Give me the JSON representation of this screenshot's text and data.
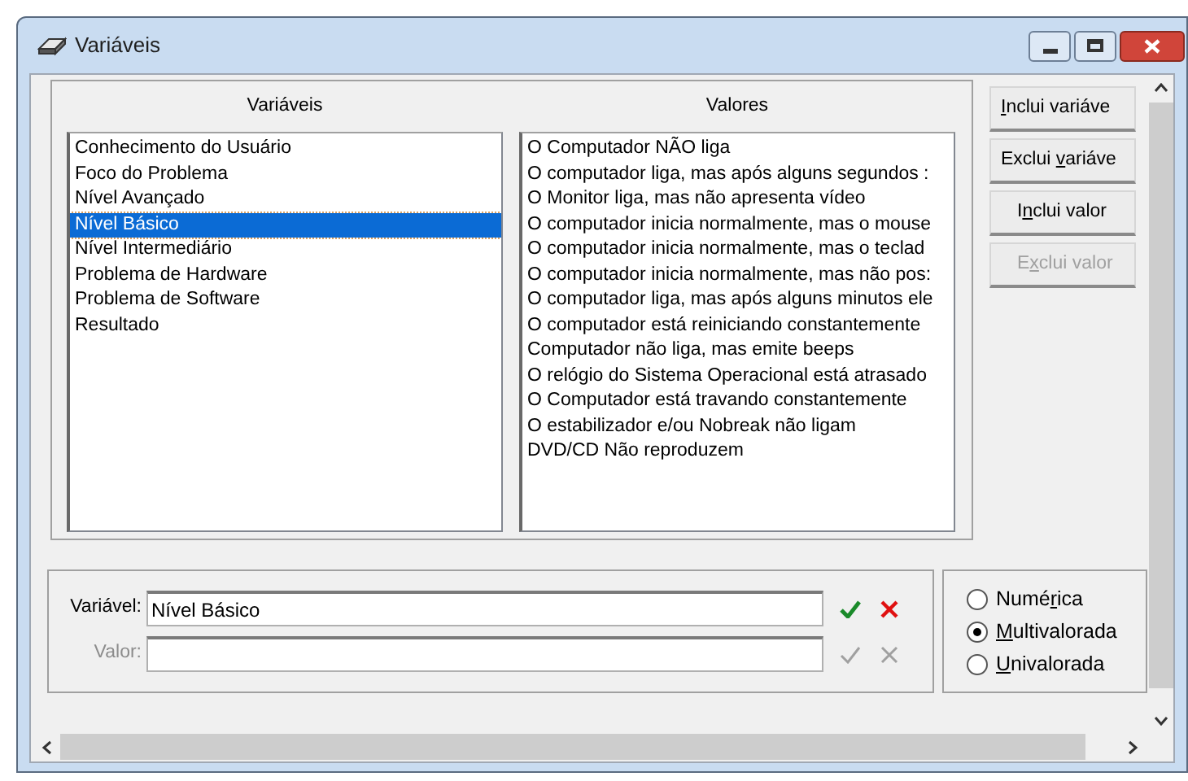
{
  "window": {
    "title": "Variáveis"
  },
  "variables": {
    "heading": "Variáveis",
    "items": [
      {
        "label": "Conhecimento do Usuário",
        "selected": false
      },
      {
        "label": "Foco do Problema",
        "selected": false
      },
      {
        "label": "Nível Avançado",
        "selected": false
      },
      {
        "label": "Nível Básico",
        "selected": true
      },
      {
        "label": "Nível Intermediário",
        "selected": false
      },
      {
        "label": "Problema de Hardware",
        "selected": false
      },
      {
        "label": "Problema de Software",
        "selected": false
      },
      {
        "label": "Resultado",
        "selected": false
      }
    ]
  },
  "values": {
    "heading": "Valores",
    "items": [
      "O Computador NÃO liga",
      "O computador liga, mas após alguns segundos :",
      "O Monitor liga, mas não apresenta vídeo",
      "O computador inicia normalmente, mas o mouse",
      "O computador inicia normalmente, mas o teclad",
      "O computador inicia normalmente, mas não pos:",
      "O computador liga, mas após alguns minutos ele",
      "O computador está reiniciando constantemente",
      "Computador não liga, mas emite beeps",
      "O relógio do Sistema Operacional está atrasado",
      "O Computador está travando constantemente",
      "O estabilizador e/ou Nobreak não ligam",
      "DVD/CD Não reproduzem"
    ]
  },
  "buttons": [
    {
      "label_parts": {
        "key": "I",
        "post": "nclui variáve"
      },
      "disabled": false
    },
    {
      "label_parts": {
        "pre": "Exclui ",
        "key": "v",
        "post": "ariáve"
      },
      "disabled": false
    },
    {
      "label_parts": {
        "pre": "I",
        "key": "n",
        "post": "clui valor"
      },
      "disabled": false
    },
    {
      "label_parts": {
        "pre": "E",
        "key": "x",
        "post": "clui valor"
      },
      "disabled": true
    }
  ],
  "fields": [
    {
      "label": "Variável:",
      "value": "Nível Básico",
      "disabled": false
    },
    {
      "label": "Valor:",
      "disabled": true
    }
  ],
  "type_options": [
    {
      "label_parts": {
        "pre": "Numé",
        "key": "r",
        "post": "ica"
      },
      "selected": false
    },
    {
      "label_parts": {
        "key": "M",
        "post": "ultivalorada"
      },
      "selected": true
    },
    {
      "label_parts": {
        "key": "U",
        "post": "nivalorada"
      },
      "selected": false
    }
  ]
}
